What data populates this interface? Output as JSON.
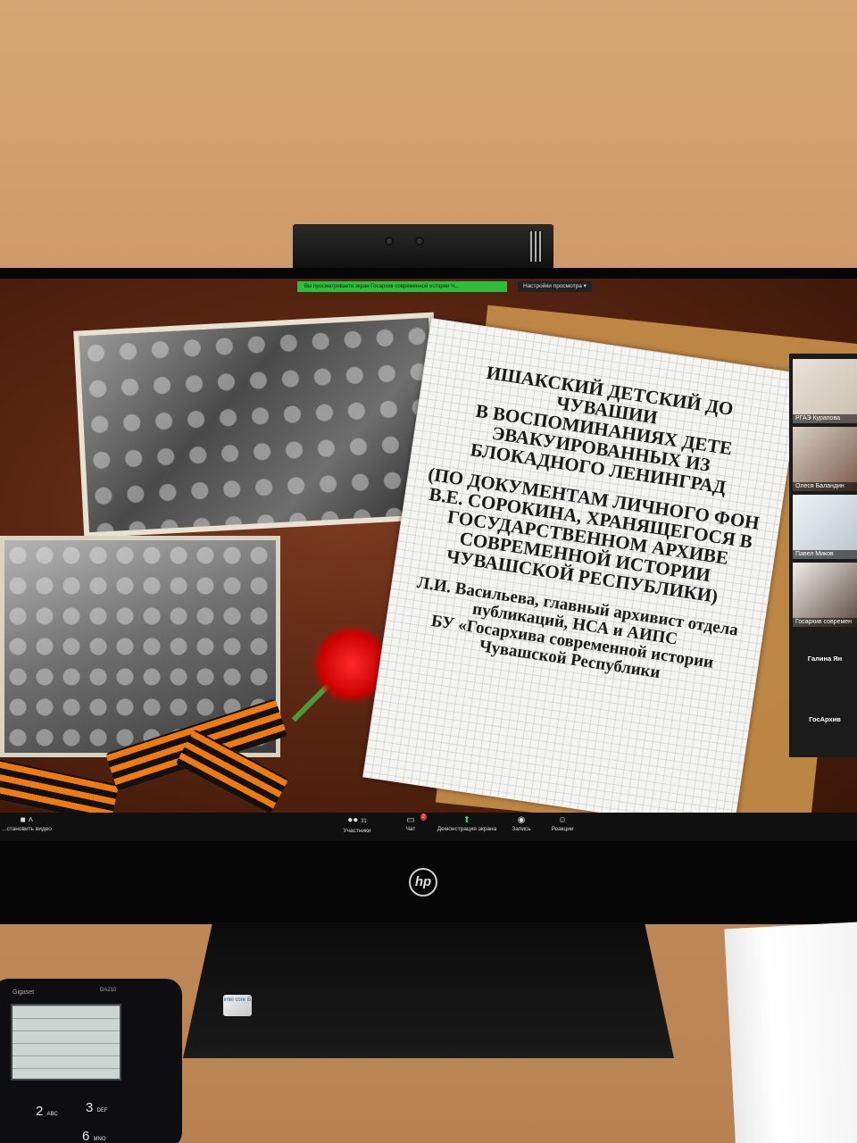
{
  "zoom_meeting": {
    "share_banner": "Вы просматриваете экран Госархив современной истории Ч...",
    "view_settings": "Настройки просмотра",
    "toolbar": {
      "video_label": "...становить видео",
      "participants_count": "31",
      "participants_label": "Участники",
      "chat_label": "Чат",
      "chat_badge": "2",
      "share_label": "Демонстрация экрана",
      "record_label": "Запись",
      "reactions_label": "Реакции"
    },
    "participants": [
      "РГАЭ Курапова",
      "Олеся Баландин",
      "Павел Миков",
      "Госархив современ",
      "Галина Ян",
      "ГосАрхив"
    ]
  },
  "slide": {
    "title_lines": [
      "ИШАКСКИЙ ДЕТСКИЙ ДО",
      "ЧУВАШИИ",
      "В ВОСПОМИНАНИЯХ ДЕТЕ",
      "ЭВАКУИРОВАННЫХ ИЗ",
      "БЛОКАДНОГО ЛЕНИНГРАД"
    ],
    "subtitle_lines": [
      "(ПО ДОКУМЕНТАМ ЛИЧНОГО ФОН",
      "В.Е. СОРОКИНА, ХРАНЯЩЕГОСЯ В",
      "ГОСУДАРСТВЕННОМ АРХИВЕ",
      "СОВРЕМЕННОЙ ИСТОРИИ",
      "ЧУВАШСКОЙ РЕСПУБЛИКИ)"
    ],
    "author_lines": [
      "Л.И. Васильева, главный архивист отдела",
      "публикаций, НСА и АИПС",
      "БУ «Госархива современной истории",
      "Чувашской Республики"
    ]
  },
  "hardware": {
    "monitor_logo": "hp",
    "sticker": "intel core i5",
    "phone_brand": "Gigaset",
    "phone_model": "DA210",
    "keys": [
      "2",
      "ABC",
      "3",
      "DEF",
      "6",
      "MNO"
    ]
  }
}
